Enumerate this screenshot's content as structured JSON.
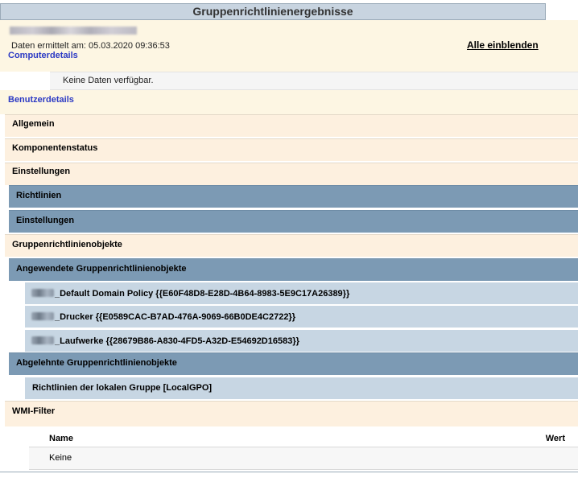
{
  "window": {
    "title": "Gruppenrichtlinienergebnisse"
  },
  "header": {
    "date_line": "Daten ermittelt am: 05.03.2020 09:36:53",
    "show_all": "Alle einblenden",
    "computer_details": "Computerdetails"
  },
  "computer": {
    "no_data": "Keine Daten verfügbar."
  },
  "sections": {
    "user_details": "Benutzerdetails",
    "general": "Allgemein",
    "component_status": "Komponentenstatus",
    "settings": "Einstellungen",
    "policies": "Richtlinien",
    "settings_sub": "Einstellungen",
    "gpos": "Gruppenrichtlinienobjekte",
    "applied_gpos": "Angewendete Gruppenrichtlinienobjekte",
    "denied_gpos": "Abgelehnte Gruppenrichtlinienobjekte",
    "wmi_filter": "WMI-Filter"
  },
  "applied_gpos": [
    {
      "label": "_Default Domain Policy {{E60F48D8-E28D-4B64-8983-5E9C17A26389}}"
    },
    {
      "label": "_Drucker {{E0589CAC-B7AD-476A-9069-66B0DE4C2722}}"
    },
    {
      "label": "_Laufwerke {{28679B86-A830-4FD5-A32D-E54692D16583}}"
    }
  ],
  "denied_gpos": [
    {
      "label": "Richtlinien der lokalen Gruppe [LocalGPO]"
    }
  ],
  "wmi_table": {
    "col_name": "Name",
    "col_value": "Wert",
    "rows": [
      {
        "name": "Keine"
      }
    ]
  },
  "colors": {
    "beige": "#fdf0df",
    "blue_header": "#7c9ab4",
    "light_blue": "#c7d6e3",
    "link": "#2c3ac4"
  }
}
